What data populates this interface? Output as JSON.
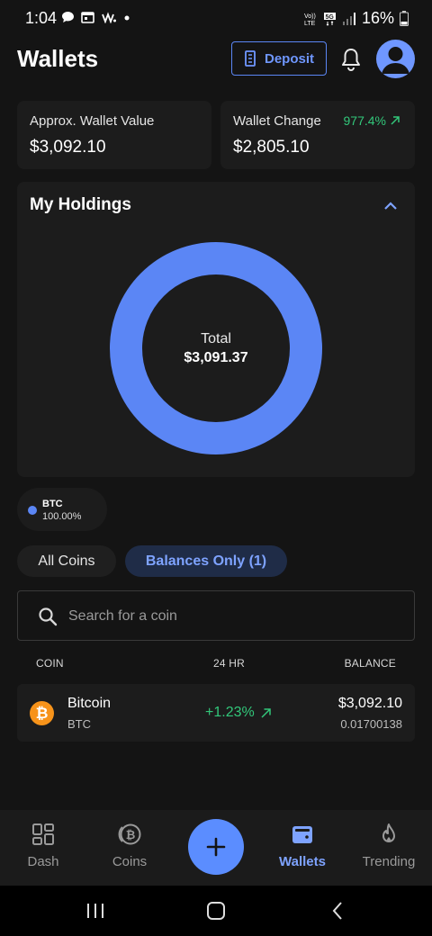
{
  "status_bar": {
    "time": "1:04",
    "battery": "16%",
    "left_icons": [
      "chat-icon",
      "calendar-icon",
      "wifi-calling-icon",
      "dot-icon"
    ],
    "right_icons": [
      "volte-icon",
      "5g-icon",
      "signal-icon",
      "battery-icon"
    ]
  },
  "header": {
    "title": "Wallets",
    "deposit_label": "Deposit"
  },
  "summary": {
    "wallet_value_label": "Approx. Wallet Value",
    "wallet_value": "$3,092.10",
    "wallet_change_label": "Wallet Change",
    "wallet_change": "$2,805.10",
    "wallet_change_pct": "977.4%"
  },
  "holdings": {
    "title": "My Holdings",
    "total_label": "Total",
    "total_value": "$3,091.37",
    "legend": [
      {
        "symbol": "BTC",
        "percent": "100.00%",
        "color": "#5b86f5"
      }
    ]
  },
  "chart_data": {
    "type": "pie",
    "categories": [
      "BTC"
    ],
    "values": [
      100.0
    ],
    "colors": [
      "#5b86f5"
    ]
  },
  "tabs": {
    "all": "All Coins",
    "balances": "Balances Only (1)"
  },
  "search": {
    "placeholder": "Search for a coin",
    "value": ""
  },
  "table": {
    "headers": {
      "coin": "COIN",
      "change": "24 HR",
      "balance": "BALANCE"
    },
    "rows": [
      {
        "name": "Bitcoin",
        "symbol": "BTC",
        "change": "+1.23%",
        "balance": "$3,092.10",
        "quantity": "0.01700138",
        "icon": "bitcoin-icon",
        "color": "#f7931a"
      }
    ]
  },
  "bottom_nav": {
    "items": [
      {
        "label": "Dash",
        "icon": "grid-icon"
      },
      {
        "label": "Coins",
        "icon": "coins-icon"
      },
      {
        "label": "Wallets",
        "icon": "wallet-icon"
      },
      {
        "label": "Trending",
        "icon": "flame-icon"
      }
    ],
    "active": "Wallets"
  },
  "colors": {
    "accent": "#5b86f5",
    "positive": "#32c77a",
    "background": "#141414",
    "card": "#1c1c1c"
  }
}
